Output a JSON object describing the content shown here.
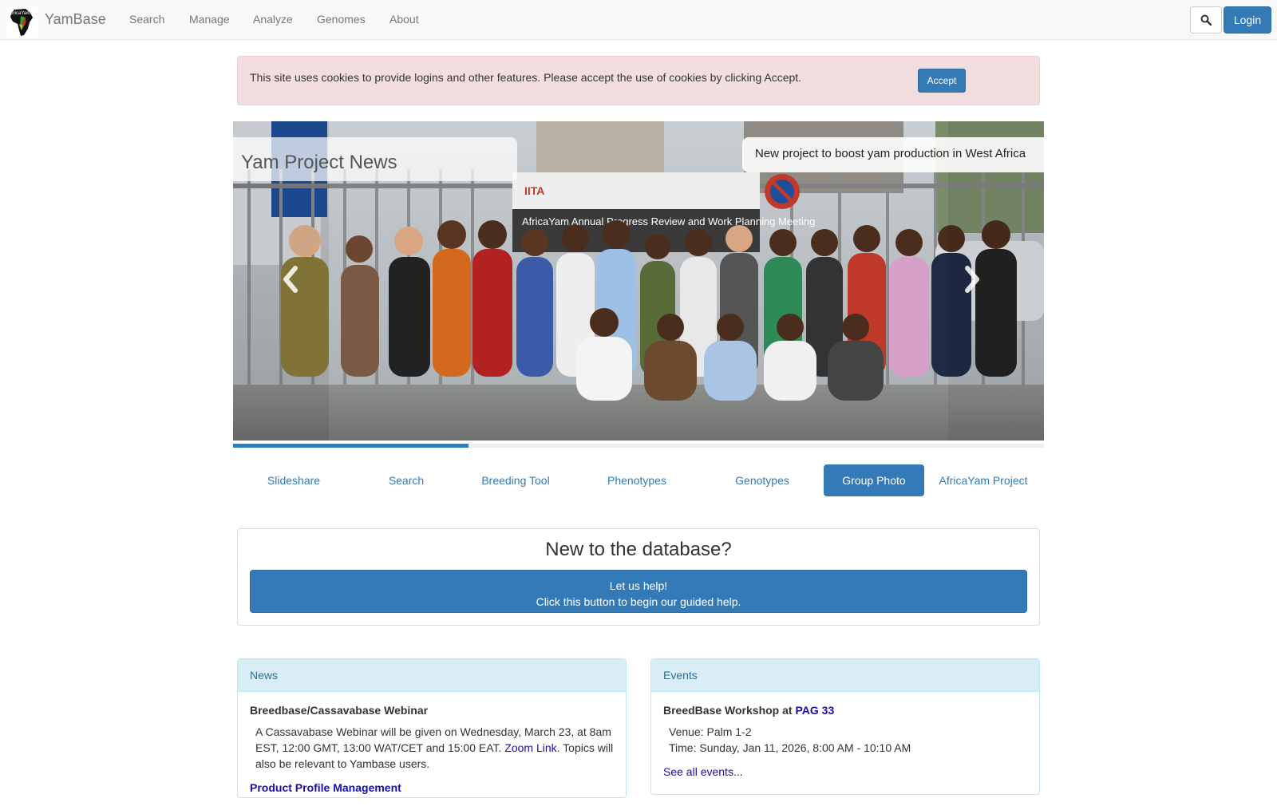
{
  "navbar": {
    "brand": "YamBase",
    "logo_text": "AfricaYam",
    "links": [
      "Search",
      "Manage",
      "Analyze",
      "Genomes",
      "About"
    ],
    "search_icon": "search-icon",
    "login_label": "Login"
  },
  "cookie_alert": {
    "message": "This site uses cookies to provide logins and other features. Please accept the use of cookies by clicking Accept.",
    "accept_label": "Accept"
  },
  "carousel": {
    "section_title": "Yam Project News",
    "ticker": "New project to boost yam production in West Africa",
    "banner_text": "AfricaYam Annual Progress Review and Work Planning Meeting",
    "banner_logo": "IITA",
    "prev_icon": "chevron-left-icon",
    "next_icon": "chevron-right-icon",
    "progress": 0.29
  },
  "tabs": {
    "items": [
      "Slideshare",
      "Search",
      "Breeding Tool",
      "Phenotypes",
      "Genotypes",
      "Group Photo",
      "AfricaYam Project"
    ],
    "active": "Group Photo"
  },
  "help_panel": {
    "title": "New to the database?",
    "button_line1": "Let us help!",
    "button_line2": "Click this button to begin our guided help."
  },
  "news": {
    "heading": "News",
    "item1_title": "Breedbase/Cassavabase Webinar",
    "item1_text_before": "A Cassavabase Webinar will be given on Wednesday, March 23, at 8am EST, 12:00 GMT, 13:00 WAT/CET and 15:00 EAT. ",
    "item1_link": "Zoom Link",
    "item1_text_after": ". Topics will also be relevant to Yambase users.",
    "item2_title": "Product Profile Management"
  },
  "events": {
    "heading": "Events",
    "item_title": "BreedBase Workshop at ",
    "item_link": "PAG 33",
    "venue": "Venue: Palm 1-2",
    "time": "Time: Sunday, Jan 11, 2026, 8:00 AM - 10:10 AM",
    "see_all": "See all events..."
  },
  "colors": {
    "primary": "#337ab7",
    "navbar_bg": "#f8f8f8",
    "alert_bg": "#f2dede",
    "panel_head_bg": "#d9edf7",
    "panel_head_text": "#31708f",
    "link": "#1a0dab"
  }
}
